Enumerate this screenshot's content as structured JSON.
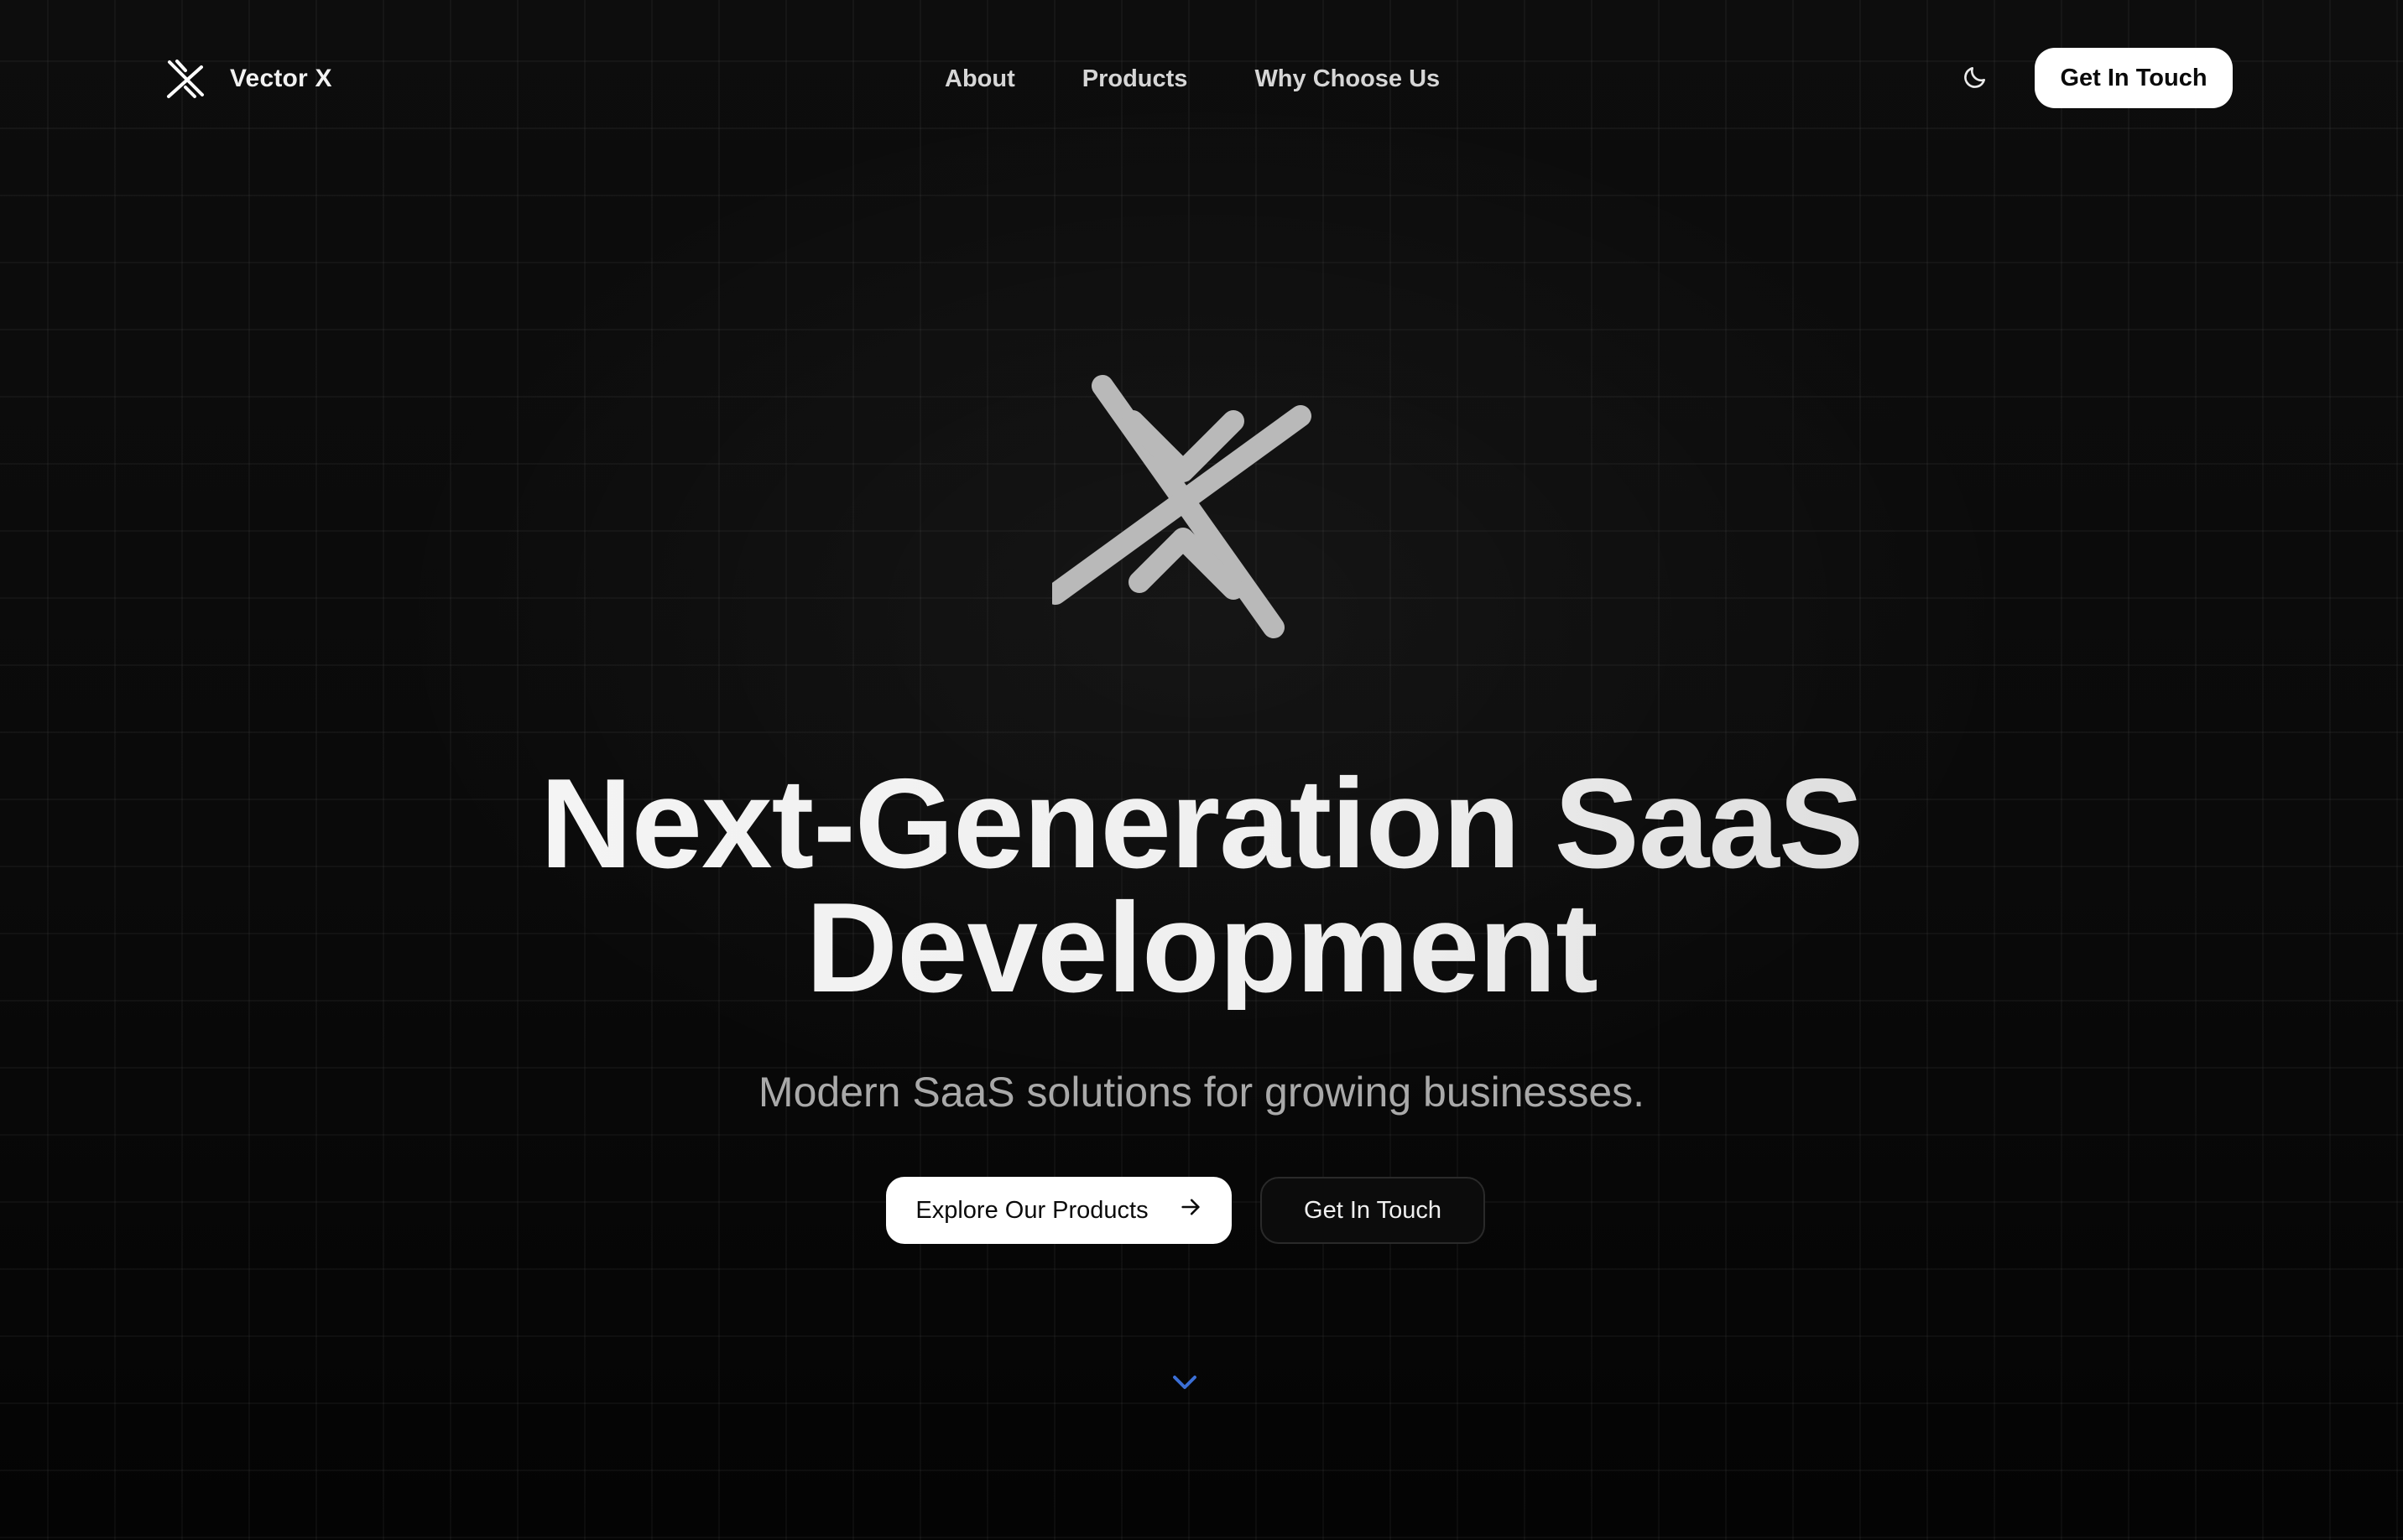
{
  "nav": {
    "brand_name": "Vector X",
    "logo_icon": "vector-x-logo-icon",
    "links": [
      {
        "label": "About"
      },
      {
        "label": "Products"
      },
      {
        "label": "Why Choose Us"
      }
    ],
    "theme_toggle_icon": "moon-icon",
    "cta_label": "Get In Touch"
  },
  "hero": {
    "logo_icon": "vector-x-logo-icon",
    "title_line1": "Next-Generation SaaS",
    "title_line2": "Development",
    "subtitle": "Modern SaaS solutions for growing businesses.",
    "primary_cta": "Explore Our Products",
    "primary_cta_icon": "arrow-right-icon",
    "secondary_cta": "Get In Touch",
    "scroll_icon": "chevron-down-icon"
  },
  "colors": {
    "background": "#0a0a0a",
    "accent_scroll": "#3b6fd6",
    "logo_gray": "#b9b9b9",
    "button_primary_bg": "#ffffff"
  }
}
